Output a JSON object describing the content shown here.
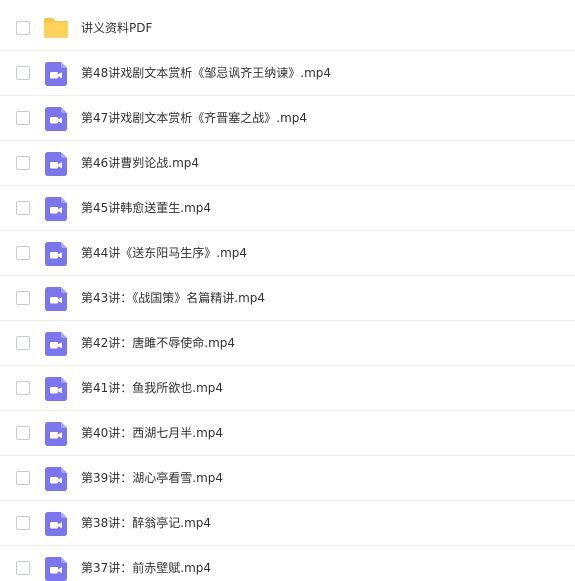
{
  "colors": {
    "folder_body": "#ffd25c",
    "folder_tab": "#f7c548",
    "video_icon_bg": "#7b75f0",
    "video_icon_fold": "#a7a2ff",
    "text": "#333333",
    "divider": "#f0f0f0"
  },
  "files": [
    {
      "name": "讲义资料PDF",
      "type": "folder",
      "icon": "folder-icon"
    },
    {
      "name": "第48讲戏剧文本赏析《邹忌讽齐王纳谏》.mp4",
      "type": "video",
      "icon": "video-file-icon"
    },
    {
      "name": "第47讲戏剧文本赏析《齐晋塞之战》.mp4",
      "type": "video",
      "icon": "video-file-icon"
    },
    {
      "name": "第46讲曹刿论战.mp4",
      "type": "video",
      "icon": "video-file-icon"
    },
    {
      "name": "第45讲韩愈送董生.mp4",
      "type": "video",
      "icon": "video-file-icon"
    },
    {
      "name": "第44讲《送东阳马生序》.mp4",
      "type": "video",
      "icon": "video-file-icon"
    },
    {
      "name": "第43讲：《战国策》名篇精讲.mp4",
      "type": "video",
      "icon": "video-file-icon"
    },
    {
      "name": "第42讲：唐雎不辱使命.mp4",
      "type": "video",
      "icon": "video-file-icon"
    },
    {
      "name": "第41讲：鱼我所欲也.mp4",
      "type": "video",
      "icon": "video-file-icon"
    },
    {
      "name": "第40讲：西湖七月半.mp4",
      "type": "video",
      "icon": "video-file-icon"
    },
    {
      "name": "第39讲：湖心亭看雪.mp4",
      "type": "video",
      "icon": "video-file-icon"
    },
    {
      "name": "第38讲：醉翁亭记.mp4",
      "type": "video",
      "icon": "video-file-icon"
    },
    {
      "name": "第37讲：前赤壁赋.mp4",
      "type": "video",
      "icon": "video-file-icon"
    }
  ]
}
